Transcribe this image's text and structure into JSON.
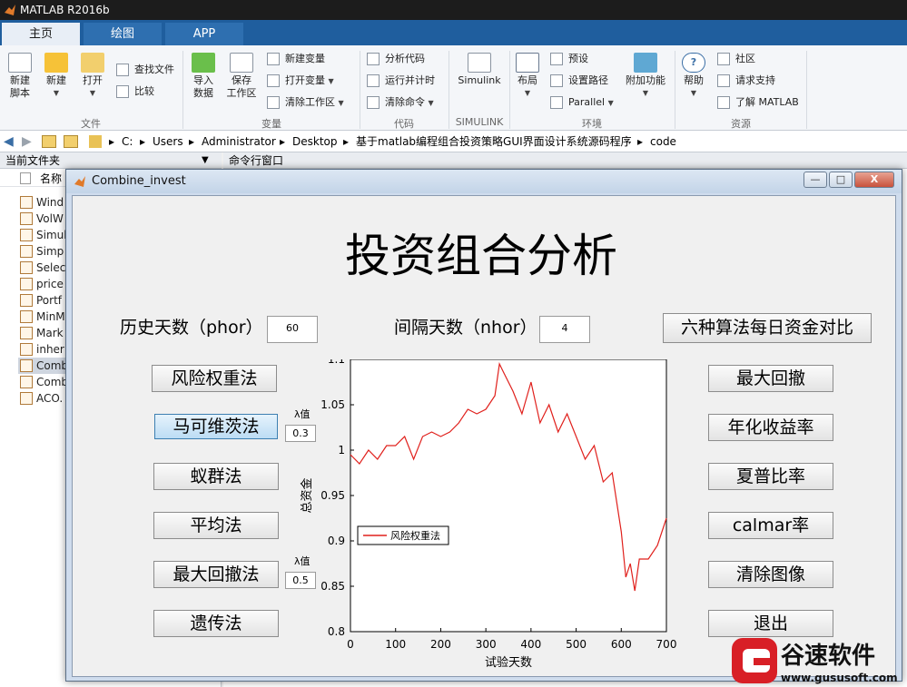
{
  "app": {
    "title": "MATLAB R2016b"
  },
  "tabs": [
    {
      "label": "主页",
      "active": true
    },
    {
      "label": "绘图",
      "active": false
    },
    {
      "label": "APP",
      "active": false
    }
  ],
  "ribbon": {
    "file": {
      "group": "文件",
      "new_script": "新建\n脚本",
      "new": "新建",
      "open": "打开",
      "find_files": "查找文件",
      "compare": "比较"
    },
    "variable": {
      "group": "变量",
      "import": "导入\n数据",
      "save_ws": "保存\n工作区",
      "new_var": "新建变量",
      "open_var": "打开变量",
      "clear_ws": "清除工作区"
    },
    "code": {
      "group": "代码",
      "analyze": "分析代码",
      "run_time": "运行并计时",
      "clear_cmd": "清除命令"
    },
    "simulink": {
      "group": "SIMULINK",
      "simulink": "Simulink"
    },
    "env": {
      "group": "环境",
      "layout": "布局",
      "prefs": "预设",
      "set_path": "设置路径",
      "parallel": "Parallel",
      "addons": "附加功能"
    },
    "resources": {
      "group": "资源",
      "help": "帮助",
      "community": "社区",
      "support": "请求支持",
      "learn": "了解 MATLAB"
    }
  },
  "address": [
    "C:",
    "Users",
    "Administrator",
    "Desktop",
    "基于matlab编程组合投资策略GUI界面设计系统源码程序",
    "code"
  ],
  "left_panel": {
    "title": "当前文件夹",
    "col_name": "名称",
    "files": [
      "Wind",
      "VolW",
      "Simul",
      "Simp",
      "Selec",
      "price",
      "Portf",
      "MinM",
      "Mark",
      "inher",
      "Comb",
      "Comb",
      "ACO."
    ],
    "selected_index": 10
  },
  "cmd": {
    "title": "命令行窗口"
  },
  "figure": {
    "title": "Combine_invest",
    "heading": "投资组合分析",
    "phor_label": "历史天数（phor）",
    "phor_value": "60",
    "nhor_label": "间隔天数（nhor）",
    "nhor_value": "4",
    "compare_button": "六种算法每日资金对比",
    "left_buttons": [
      "风险权重法",
      "马可维茨法",
      "蚁群法",
      "平均法",
      "最大回撤法",
      "遗传法"
    ],
    "lambda_label": "λ值",
    "lambda1_value": "0.3",
    "lambda2_value": "0.5",
    "right_buttons": [
      "最大回撤",
      "年化收益率",
      "夏普比率",
      "calmar率",
      "清除图像",
      "退出"
    ],
    "window_buttons": {
      "min": "—",
      "max": "□",
      "close": "X"
    }
  },
  "chart_data": {
    "type": "line",
    "xlabel": "试验天数",
    "ylabel": "总资金",
    "xlim": [
      0,
      700
    ],
    "ylim": [
      0.8,
      1.1
    ],
    "xticks": [
      "0",
      "100",
      "200",
      "300",
      "400",
      "500",
      "600",
      "700"
    ],
    "yticks": [
      "1.1",
      "1.05",
      "1",
      "0.95",
      "0.9",
      "0.85",
      "0.8"
    ],
    "legend": "风险权重法",
    "legend_position": "left",
    "color": "#e0201c",
    "series": [
      {
        "name": "风险权重法",
        "x": [
          0,
          20,
          40,
          60,
          80,
          100,
          120,
          140,
          160,
          180,
          200,
          220,
          240,
          260,
          280,
          300,
          320,
          330,
          340,
          360,
          380,
          400,
          420,
          440,
          460,
          480,
          500,
          520,
          540,
          560,
          580,
          600,
          610,
          620,
          630,
          640,
          660,
          680,
          700
        ],
        "y": [
          0.995,
          0.985,
          1.0,
          0.99,
          1.005,
          1.005,
          1.015,
          0.99,
          1.015,
          1.02,
          1.015,
          1.02,
          1.03,
          1.045,
          1.04,
          1.045,
          1.06,
          1.095,
          1.085,
          1.065,
          1.04,
          1.075,
          1.03,
          1.05,
          1.02,
          1.04,
          1.015,
          0.99,
          1.005,
          0.965,
          0.975,
          0.91,
          0.86,
          0.875,
          0.845,
          0.88,
          0.88,
          0.895,
          0.925
        ]
      }
    ]
  },
  "watermark": {
    "brand": "谷速软件",
    "url": "www.gususoft.com"
  }
}
